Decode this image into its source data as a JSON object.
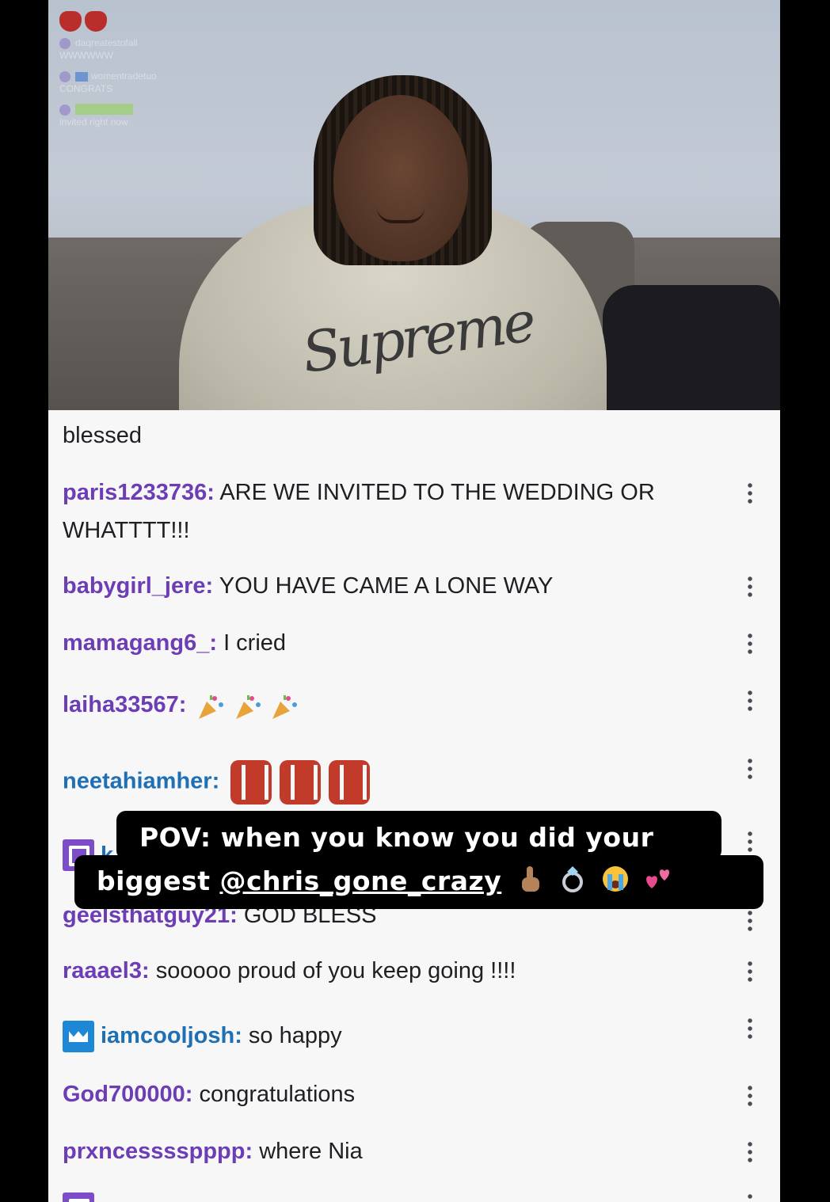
{
  "stream": {
    "overlay_chat": [
      {
        "user": "daqreatestofall",
        "text": "WWWWWW"
      },
      {
        "user": "womentradetuo",
        "text": "CONGRATS"
      },
      {
        "user": "",
        "text": "invited right now"
      }
    ]
  },
  "chat": {
    "messages": [
      {
        "user": "",
        "text": "blessed"
      },
      {
        "user": "paris1233736:",
        "text": " ARE WE INVITED TO THE WEDDING OR WHATTTT!!!"
      },
      {
        "user": "babygirl_jere:",
        "text": " YOU HAVE CAME A LONE WAY"
      },
      {
        "user": "mamagang6_:",
        "text": " I cried"
      },
      {
        "user": "laiha33567:",
        "text": ""
      },
      {
        "user": "neetahiamher:",
        "text": ""
      },
      {
        "user": "k",
        "text": ""
      },
      {
        "user": "geelsthatguy21:",
        "text": " GOD BLESS"
      },
      {
        "user": "raaael3:",
        "text": " sooooo proud of you keep going !!!!"
      },
      {
        "user": "iamcooljosh:",
        "text": " so happy"
      },
      {
        "user": "God700000:",
        "text": " congratulations"
      },
      {
        "user": "prxncesssspppp:",
        "text": " where Nia"
      }
    ]
  },
  "caption": {
    "line1": "POV: when you know you did your",
    "line2_prefix": "biggest ",
    "mention": "@chris_gone_crazy"
  },
  "colors": {
    "username": "#6c3db5",
    "chat_bg": "#f7f7f8",
    "caption_bg": "#000000"
  }
}
